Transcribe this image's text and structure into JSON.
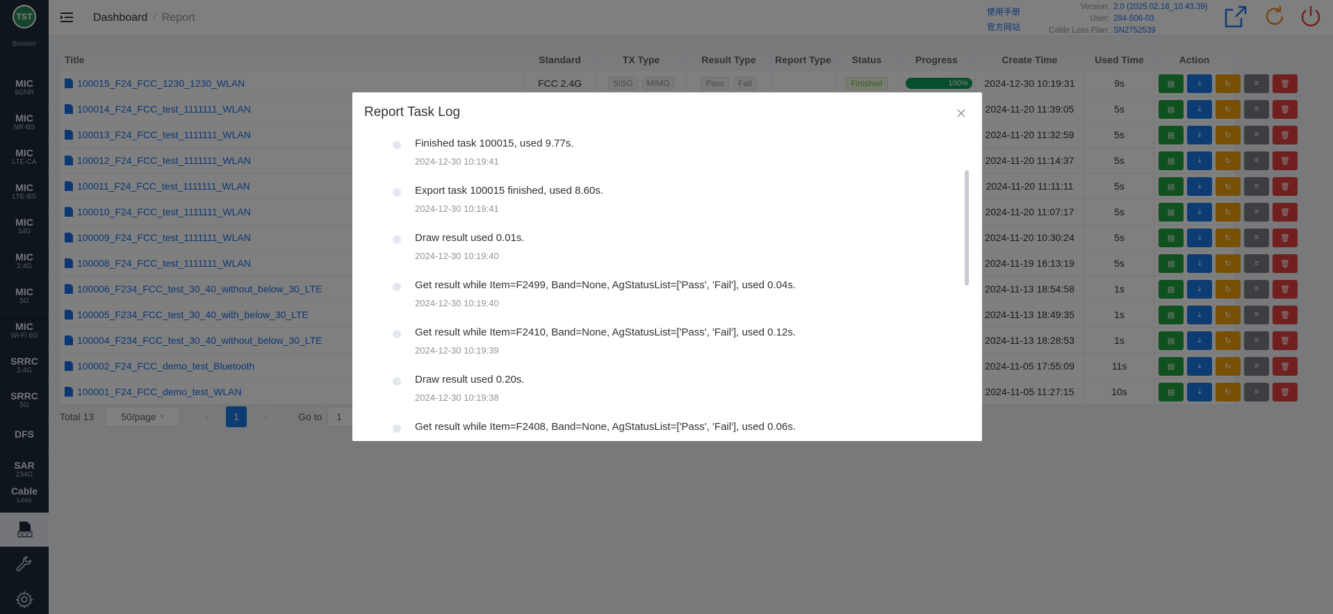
{
  "sidebar": {
    "logo": "TST",
    "logo_sub": "Booster",
    "items": [
      {
        "main": "MIC",
        "sub": "5GNR"
      },
      {
        "main": "MIC",
        "sub": "NR-BS"
      },
      {
        "main": "MIC",
        "sub": "LTE-CA"
      },
      {
        "main": "MIC",
        "sub": "LTE-BS"
      },
      {
        "main": "MIC",
        "sub": "34G"
      },
      {
        "main": "MIC",
        "sub": "2.4G"
      },
      {
        "main": "MIC",
        "sub": "5G"
      },
      {
        "main": "MIC",
        "sub": "Wi-Fi 6G"
      },
      {
        "main": "SRRC",
        "sub": "2.4G"
      },
      {
        "main": "SRRC",
        "sub": "5G"
      },
      {
        "main": "DFS",
        "sub": ""
      },
      {
        "main": "SAR",
        "sub": "234G"
      },
      {
        "main": "Cable",
        "sub": "Loss"
      }
    ],
    "doc_label": "DOC"
  },
  "header": {
    "breadcrumb": [
      "Dashboard",
      "Report"
    ],
    "links": [
      "使用手册",
      "官方网站"
    ],
    "version_label": "Version:",
    "version": "2.0 (2025.02.18_10.43.39)",
    "user_label": "User:",
    "user": "284-506-03",
    "plan_label": "Cable Loss Plan:",
    "plan": "SN2752539"
  },
  "table": {
    "columns": [
      "Title",
      "Standard",
      "TX Type",
      "Result Type",
      "Report Type",
      "Status",
      "Progress",
      "Create Time",
      "Used Time",
      "Action"
    ],
    "rows": [
      {
        "title": "100015_F24_FCC_1230_1230_WLAN",
        "standard": "FCC 2.4G",
        "tx": [
          "SISO",
          "MIMO"
        ],
        "result": [
          "Pass",
          "Fail"
        ],
        "status": "Finished",
        "progress": "100%",
        "create": "2024-12-30 10:19:31",
        "used": "9s"
      },
      {
        "title": "100014_F24_FCC_test_1111111_WLAN",
        "create": "2024-11-20 11:39:05",
        "used": "5s"
      },
      {
        "title": "100013_F24_FCC_test_1111111_WLAN",
        "create": "2024-11-20 11:32:59",
        "used": "5s"
      },
      {
        "title": "100012_F24_FCC_test_1111111_WLAN",
        "create": "2024-11-20 11:14:37",
        "used": "5s"
      },
      {
        "title": "100011_F24_FCC_test_1111111_WLAN",
        "create": "2024-11-20 11:11:11",
        "used": "5s"
      },
      {
        "title": "100010_F24_FCC_test_1111111_WLAN",
        "create": "2024-11-20 11:07:17",
        "used": "5s"
      },
      {
        "title": "100009_F24_FCC_test_1111111_WLAN",
        "create": "2024-11-20 10:30:24",
        "used": "5s"
      },
      {
        "title": "100008_F24_FCC_test_1111111_WLAN",
        "create": "2024-11-19 16:13:19",
        "used": "5s"
      },
      {
        "title": "100006_F234_FCC_test_30_40_without_below_30_LTE",
        "create": "2024-11-13 18:54:58",
        "used": "1s"
      },
      {
        "title": "100005_F234_FCC_test_30_40_with_below_30_LTE",
        "create": "2024-11-13 18:49:35",
        "used": "1s"
      },
      {
        "title": "100004_F234_FCC_test_30_40_without_below_30_LTE",
        "create": "2024-11-13 18:28:53",
        "used": "1s"
      },
      {
        "title": "100002_F24_FCC_demo_test_Bluetooth",
        "create": "2024-11-05 17:55:09",
        "used": "11s"
      },
      {
        "title": "100001_F24_FCC_demo_test_WLAN",
        "create": "2024-11-05 11:27:15",
        "used": "10s"
      }
    ]
  },
  "pager": {
    "total": "Total 13",
    "size": "50/page",
    "current": "1",
    "goto": "Go to",
    "goto_value": "1"
  },
  "modal": {
    "title": "Report Task Log",
    "entries": [
      {
        "msg": "Finished task 100015, used 9.77s.",
        "ts": "2024-12-30 10:19:41"
      },
      {
        "msg": "Export task 100015 finished, used 8.60s.",
        "ts": "2024-12-30 10:19:41"
      },
      {
        "msg": "Draw result used 0.01s.",
        "ts": "2024-12-30 10:19:40"
      },
      {
        "msg": "Get result while Item=F2499, Band=None, AgStatusList=['Pass', 'Fail'], used 0.04s.",
        "ts": "2024-12-30 10:19:40"
      },
      {
        "msg": "Get result while Item=F2410, Band=None, AgStatusList=['Pass', 'Fail'], used 0.12s.",
        "ts": "2024-12-30 10:19:39"
      },
      {
        "msg": "Draw result used 0.20s.",
        "ts": "2024-12-30 10:19:38"
      },
      {
        "msg": "Get result while Item=F2408, Band=None, AgStatusList=['Pass', 'Fail'], used 0.06s.",
        "ts": ""
      }
    ]
  },
  "colors": {
    "sidebar_bg": "#1d2a3a",
    "accent_blue": "#1a78e6",
    "btn_green": "#21a53e",
    "btn_orange": "#f0a10a",
    "btn_gray": "#7a7d82",
    "btn_red": "#e34141"
  }
}
